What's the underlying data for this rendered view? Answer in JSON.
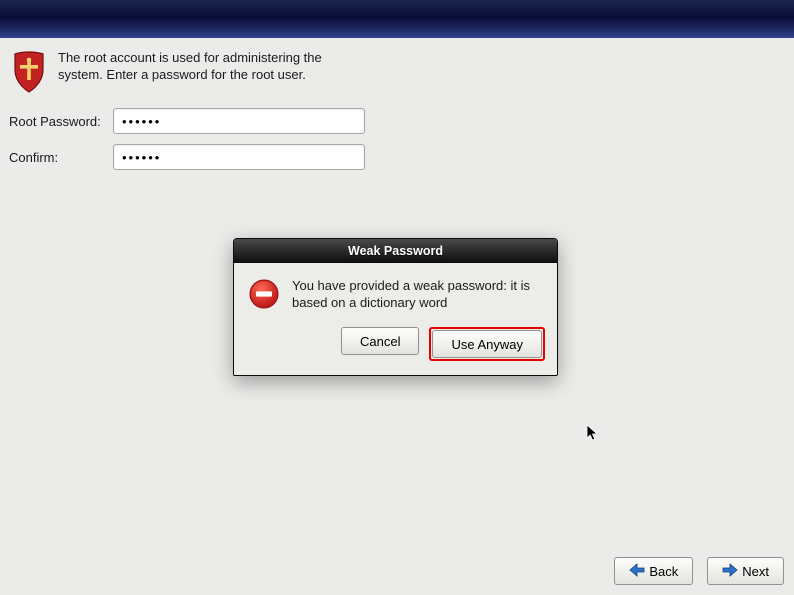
{
  "intro_text": "The root account is used for administering the system.  Enter a password for the root user.",
  "fields": {
    "root_label": "Root Password:",
    "root_value": "••••••",
    "confirm_label": "Confirm:",
    "confirm_value": "••••••"
  },
  "dialog": {
    "title": "Weak Password",
    "message": "You have provided a weak password: it is based on a dictionary word",
    "cancel": "Cancel",
    "use_anyway": "Use Anyway"
  },
  "nav": {
    "back": "Back",
    "next": "Next"
  }
}
